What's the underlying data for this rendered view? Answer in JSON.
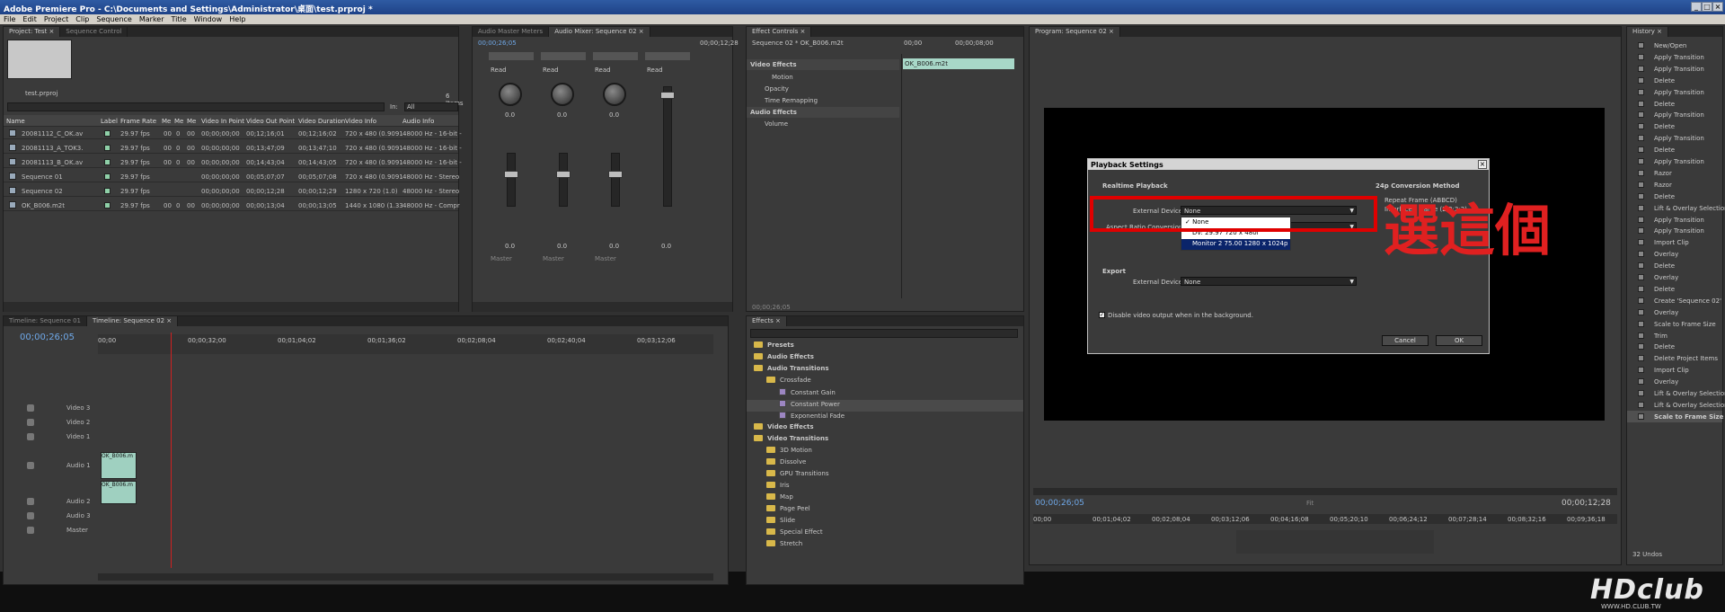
{
  "window": {
    "title": "Adobe Premiere Pro - C:\\Documents and Settings\\Administrator\\桌面\\test.prproj *",
    "controls": [
      "_",
      "□",
      "×"
    ]
  },
  "menu": [
    "File",
    "Edit",
    "Project",
    "Clip",
    "Sequence",
    "Marker",
    "Title",
    "Window",
    "Help"
  ],
  "project": {
    "tabs": [
      "Project: Test ×",
      "Sequence Control"
    ],
    "file": "test.prproj",
    "count": "6 Items",
    "in_label": "In:",
    "in_value": "All",
    "columns": [
      "Name",
      "Label",
      "Frame Rate",
      "Me",
      "Me",
      "Me",
      "Video In Point",
      "Video Out Point",
      "Video Duration",
      "Video Info",
      "Audio Info"
    ],
    "rows": [
      {
        "name": "20081112_C_OK.av",
        "rate": "29.97 fps",
        "m1": "00",
        "m2": "0",
        "m3": "00",
        "vin": "00;00;00;00",
        "vout": "00;12;16;01",
        "dur": "00;12;16;02",
        "info": "720 x 480 (0.9091",
        "audio": "48000 Hz - 16-bit -"
      },
      {
        "name": "20081113_A_TOK3.",
        "rate": "29.97 fps",
        "m1": "00",
        "m2": "0",
        "m3": "00",
        "vin": "00;00;00;00",
        "vout": "00;13;47;09",
        "dur": "00;13;47;10",
        "info": "720 x 480 (0.9091",
        "audio": "48000 Hz - 16-bit -"
      },
      {
        "name": "20081113_B_OK.av",
        "rate": "29.97 fps",
        "m1": "00",
        "m2": "0",
        "m3": "00",
        "vin": "00;00;00;00",
        "vout": "00;14;43;04",
        "dur": "00;14;43;05",
        "info": "720 x 480 (0.9091",
        "audio": "48000 Hz - 16-bit -"
      },
      {
        "name": "Sequence 01",
        "rate": "29.97 fps",
        "m1": "",
        "m2": "",
        "m3": "",
        "vin": "00;00;00;00",
        "vout": "00;05;07;07",
        "dur": "00;05;07;08",
        "info": "720 x 480 (0.9091",
        "audio": "48000 Hz - Stereo"
      },
      {
        "name": "Sequence 02",
        "rate": "29.97 fps",
        "m1": "",
        "m2": "",
        "m3": "",
        "vin": "00;00;00;00",
        "vout": "00;00;12;28",
        "dur": "00;00;12;29",
        "info": "1280 x 720 (1.0)",
        "audio": "48000 Hz - Stereo"
      },
      {
        "name": "OK_B006.m2t",
        "rate": "29.97 fps",
        "m1": "00",
        "m2": "0",
        "m3": "00",
        "vin": "00;00;00;00",
        "vout": "00;00;13;04",
        "dur": "00;00;13;05",
        "info": "1440 x 1080 (1.33",
        "audio": "48000 Hz - Compr"
      }
    ]
  },
  "mixer": {
    "tabs": [
      "Audio Master Meters",
      "Audio Mixer: Sequence 02 ×"
    ],
    "timecode": "00;00;26;05",
    "timecode2": "00;00;12;28",
    "ch_labels": [
      "Audio 1",
      "Audio 2",
      "Audio 3",
      "Master"
    ],
    "read": "Read",
    "values": [
      "0.0",
      "0.0",
      "0.0"
    ],
    "fader_vals": [
      "0.0",
      "0.0",
      "0.0",
      "0.0"
    ],
    "out": "Master"
  },
  "effect_controls": {
    "tabs": [
      "Effect Controls ×"
    ],
    "sequence": "Sequence 02 * OK_B006.m2t",
    "tc_start": "00;00",
    "tc_end": "00;00;08;00",
    "clip": "OK_B006.m2t",
    "items": [
      "Video Effects",
      "Motion",
      "Opacity",
      "Time Remapping",
      "Audio Effects",
      "Volume"
    ],
    "bottom_tc": "00;00;26;05"
  },
  "program": {
    "tabs": [
      "Program: Sequence 02 ×"
    ],
    "timecode": "00;00;26;05",
    "end_tc": "00;00;12;28",
    "fit": "Fit",
    "ruler": [
      "00;00",
      "00;01;04;02",
      "00;02;08;04",
      "00;03;12;06",
      "00;04;16;08",
      "00;05;20;10",
      "00;06;24;12",
      "00;07;28;14",
      "00;08;32;16",
      "00;09;36;18"
    ]
  },
  "history": {
    "tabs": [
      "History ×"
    ],
    "undos": "32 Undos",
    "items": [
      "New/Open",
      "Apply Transition",
      "Apply Transition",
      "Delete",
      "Apply Transition",
      "Delete",
      "Apply Transition",
      "Delete",
      "Apply Transition",
      "Delete",
      "Apply Transition",
      "Razor",
      "Razor",
      "Delete",
      "Lift & Overlay Selection",
      "Apply Transition",
      "Apply Transition",
      "Import Clip",
      "Overlay",
      "Delete",
      "Overlay",
      "Delete",
      "Create 'Sequence 02'",
      "Overlay",
      "Scale to Frame Size",
      "Trim",
      "Delete",
      "Delete Project Items",
      "Import Clip",
      "Overlay",
      "Lift & Overlay Selection",
      "Lift & Overlay Selection",
      "Scale to Frame Size"
    ]
  },
  "timeline": {
    "tabs": [
      "Timeline: Sequence 01",
      "Timeline: Sequence 02 ×"
    ],
    "timecode": "00;00;26;05",
    "ruler": [
      "00;00",
      "00;00;32;00",
      "00;01;04;02",
      "00;01;36;02",
      "00;02;08;04",
      "00;02;40;04",
      "00;03;12;06"
    ],
    "tracks": [
      "Video 3",
      "Video 2",
      "Video 1",
      "Audio 1",
      "Audio 2",
      "Audio 3",
      "Master"
    ],
    "clip": "OK_B006.m"
  },
  "effects": {
    "tabs": [
      "Effects ×"
    ],
    "tree": [
      {
        "t": "Presets",
        "lvl": 0,
        "k": "folder",
        "b": true
      },
      {
        "t": "Audio Effects",
        "lvl": 0,
        "k": "folder",
        "b": true
      },
      {
        "t": "Audio Transitions",
        "lvl": 0,
        "k": "folder",
        "b": true
      },
      {
        "t": "Crossfade",
        "lvl": 1,
        "k": "folder"
      },
      {
        "t": "Constant Gain",
        "lvl": 2,
        "k": "fx"
      },
      {
        "t": "Constant Power",
        "lvl": 2,
        "k": "fx"
      },
      {
        "t": "Exponential Fade",
        "lvl": 2,
        "k": "fx"
      },
      {
        "t": "Video Effects",
        "lvl": 0,
        "k": "folder",
        "b": true
      },
      {
        "t": "Video Transitions",
        "lvl": 0,
        "k": "folder",
        "b": true
      },
      {
        "t": "3D Motion",
        "lvl": 1,
        "k": "folder"
      },
      {
        "t": "Dissolve",
        "lvl": 1,
        "k": "folder"
      },
      {
        "t": "GPU Transitions",
        "lvl": 1,
        "k": "folder"
      },
      {
        "t": "Iris",
        "lvl": 1,
        "k": "folder"
      },
      {
        "t": "Map",
        "lvl": 1,
        "k": "folder"
      },
      {
        "t": "Page Peel",
        "lvl": 1,
        "k": "folder"
      },
      {
        "t": "Slide",
        "lvl": 1,
        "k": "folder"
      },
      {
        "t": "Special Effect",
        "lvl": 1,
        "k": "folder"
      },
      {
        "t": "Stretch",
        "lvl": 1,
        "k": "folder"
      }
    ]
  },
  "dialog": {
    "title": "Playback Settings",
    "realtime": "Realtime Playback",
    "ext_dev_label": "External Device:",
    "ext_dev_value": "None",
    "aspect_label": "Aspect Ratio Conversion:",
    "dropdown": [
      "None",
      "DV: 29.97 720 x 480i",
      "Monitor 2 75.00 1280 x 1024p"
    ],
    "check": "✓",
    "conv_title": "24p Conversion Method",
    "conv_opt1": "Repeat Frame (ABBCD)",
    "conv_opt2": "Interlaced Frame (2:3:3:2)",
    "export": "Export",
    "exp_dev_label": "External Device:",
    "exp_dev_value": "None",
    "disable": "Disable video output when in the background.",
    "cancel": "Cancel",
    "ok": "OK"
  },
  "annotation": {
    "text": "選這個",
    "color": "#e00000"
  },
  "watermark": {
    "logo": "HDclub",
    "sub": "WWW.HD.CLUB.TW"
  }
}
